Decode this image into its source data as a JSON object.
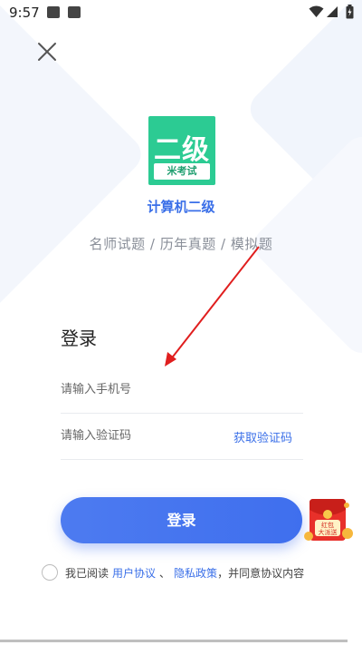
{
  "status_bar": {
    "time": "9:57"
  },
  "app": {
    "logo_text": "二级",
    "logo_subtitle": "米考试",
    "name": "计算机二级",
    "tagline": "名师试题 / 历年真题 / 模拟题"
  },
  "login": {
    "title": "登录",
    "phone_placeholder": "请输入手机号",
    "code_placeholder": "请输入验证码",
    "get_code_label": "获取验证码",
    "submit_label": "登录"
  },
  "agreement": {
    "prefix": "我已阅读",
    "user_agreement": "用户协议",
    "separator": "、",
    "privacy_policy": "隐私政策",
    "suffix": "，并同意协议内容",
    "checked": false
  },
  "promo": {
    "text_line1": "红包",
    "text_line2": "大派送"
  },
  "colors": {
    "accent": "#3f6fee",
    "logo_bg": "#2ccb93",
    "arrow": "#e01e1e"
  }
}
